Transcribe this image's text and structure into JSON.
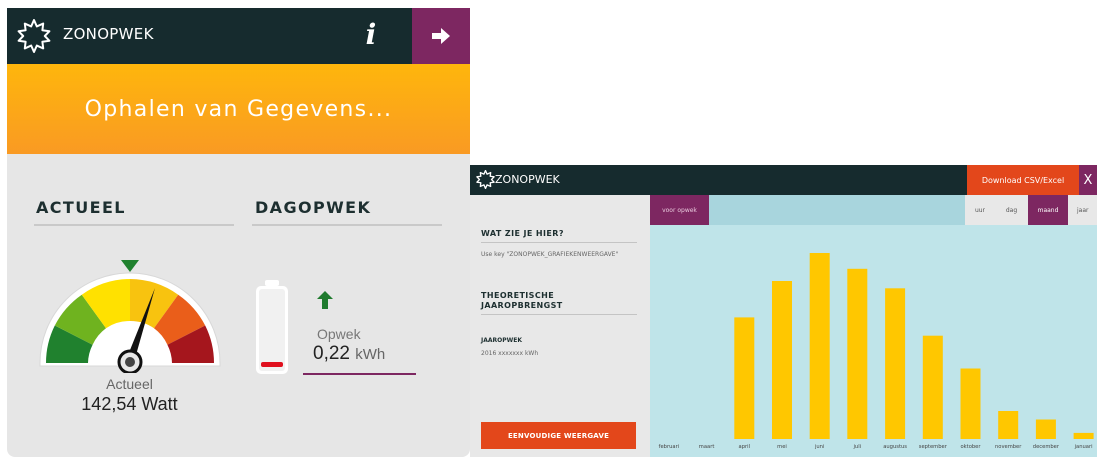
{
  "widget_main": {
    "brand": "ZONOPWEK",
    "banner_text": "Ophalen van Gegevens...",
    "section_actueel": "ACTUEEL",
    "section_dagopwek": "DAGOPWEK",
    "gauge_caption": "Actueel",
    "gauge_value": "142,54 Watt",
    "opwek_caption": "Opwek",
    "opwek_value": "0,22",
    "opwek_unit": "kWh",
    "colors": {
      "header": "#162b2e",
      "accent_purple": "#7d2761",
      "banner_orange": "#fbab17"
    }
  },
  "widget_chart": {
    "brand": "ZONOPWEK",
    "download_label": "Download CSV/Excel",
    "close_label": "X",
    "sidebar": {
      "wat_title": "WAT ZIE JE HIER?",
      "wat_text": "Use key \"ZONOPWEK_GRAFIEKENWEERGAVE\"",
      "theoretische_title_line1": "THEORETISCHE",
      "theoretische_title_line2": "JAAROPBRENGST",
      "jaaropwek_title": "JAAROPWEK",
      "jaaropwek_value": "2016 xxxxxxx kWh",
      "simple_view_button": "EENVOUDIGE WEERGAVE"
    },
    "tabs": {
      "voor_opwek": "voor opwek",
      "periods": [
        "uur",
        "dag",
        "maand",
        "jaar"
      ],
      "active_period": "maand"
    },
    "colors": {
      "bar": "#ffc700",
      "panel": "#bfe4e9",
      "button": "#e3471b"
    }
  },
  "chart_data": {
    "type": "bar",
    "categories": [
      "februari",
      "maart",
      "april",
      "mei",
      "juni",
      "juli",
      "augustus",
      "september",
      "oktober",
      "november",
      "december",
      "januari"
    ],
    "values": [
      0,
      0,
      100,
      130,
      153,
      140,
      124,
      85,
      58,
      23,
      16,
      5
    ],
    "title": "",
    "xlabel": "",
    "ylabel": "",
    "grid": false
  }
}
